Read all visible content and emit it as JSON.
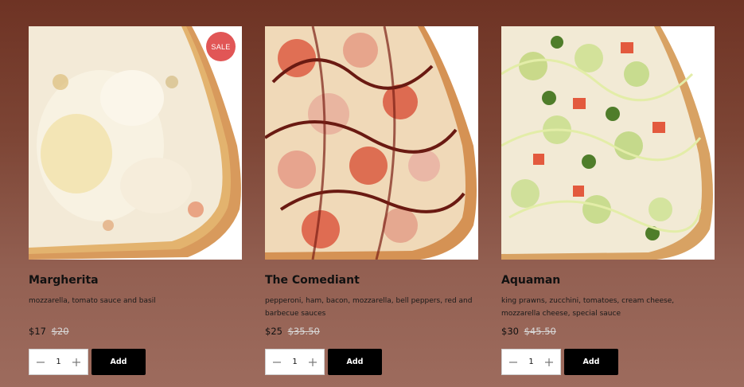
{
  "products": [
    {
      "name": "Margherita",
      "description": "mozzarella, tomato sauce and basil",
      "price": "$17",
      "old_price": "$20",
      "badge": "SALE",
      "quantity": "1",
      "add_label": "Add"
    },
    {
      "name": "The Comediant",
      "description": "pepperoni, ham, bacon, mozzarella, bell peppers, red and barbecue sauces",
      "price": "$25",
      "old_price": "$35.50",
      "quantity": "1",
      "add_label": "Add"
    },
    {
      "name": "Aquaman",
      "description": "king prawns, zucchini, tomatoes, cream cheese, mozzarella cheese, special sauce",
      "price": "$30",
      "old_price": "$45.50",
      "quantity": "1",
      "add_label": "Add"
    }
  ],
  "colors": {
    "background_top": "#6e3324",
    "background_bottom": "#9d6b5d",
    "sale_badge": "#e15656",
    "add_button": "#000000"
  },
  "icons": {
    "decrement": "minus-icon",
    "increment": "plus-icon"
  }
}
